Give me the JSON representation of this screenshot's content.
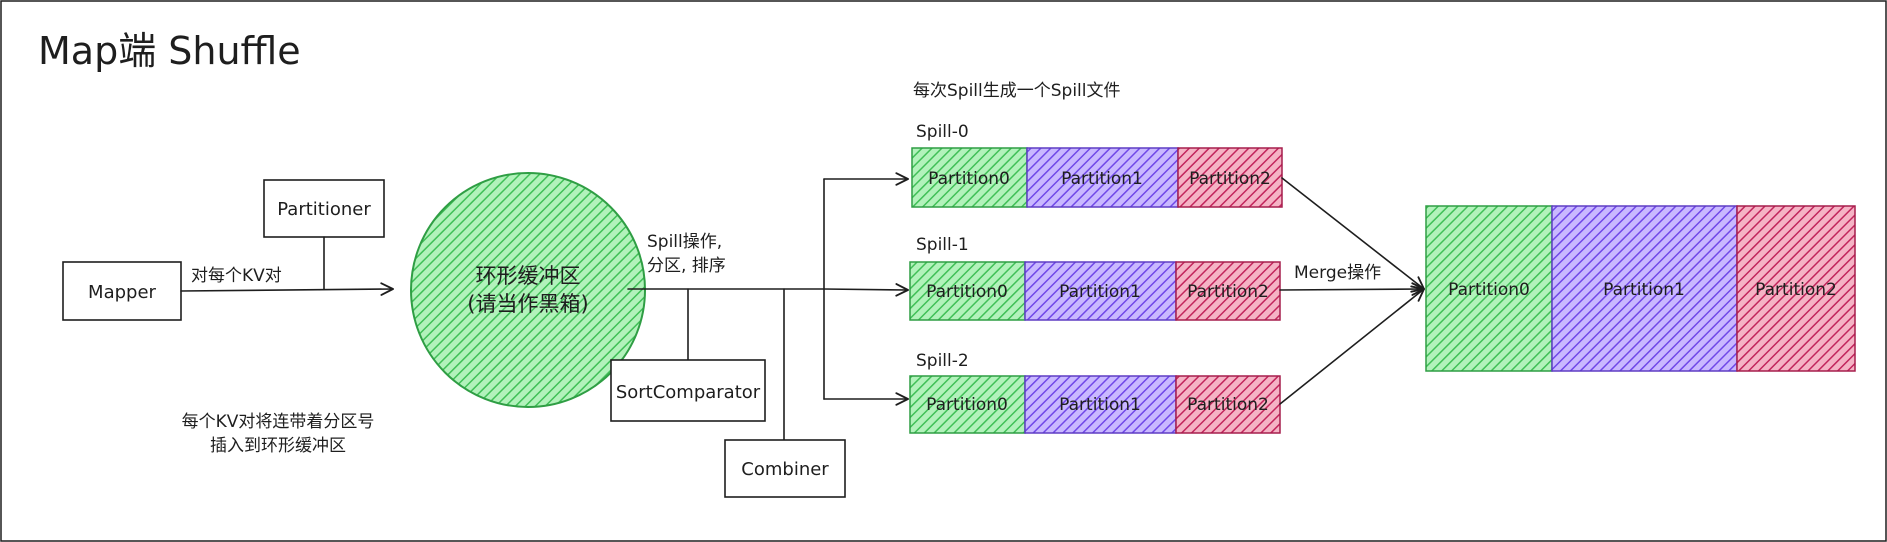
{
  "title": "Map端 Shuffle",
  "mapper_label": "Mapper",
  "partitioner_label": "Partitioner",
  "per_kv_label": "对每个KV对",
  "buffer_label_line1": "环形缓冲区",
  "buffer_label_line2": "(请当作黑箱)",
  "note_line1": "每个KV对将连带着分区号",
  "note_line2": "插入到环形缓冲区",
  "spill_op_line1": "Spill操作,",
  "spill_op_line2": "分区, 排序",
  "sort_comparator_label": "SortComparator",
  "combiner_label": "Combiner",
  "spill_note": "每次Spill生成一个Spill文件",
  "spills": [
    {
      "name": "Spill-0",
      "partitions": [
        "Partition0",
        "Partition1",
        "Partition2"
      ]
    },
    {
      "name": "Spill-1",
      "partitions": [
        "Partition0",
        "Partition1",
        "Partition2"
      ]
    },
    {
      "name": "Spill-2",
      "partitions": [
        "Partition0",
        "Partition1",
        "Partition2"
      ]
    }
  ],
  "merge_label": "Merge操作",
  "merged_partitions": [
    "Partition0",
    "Partition1",
    "Partition2"
  ],
  "colors": {
    "partition0": "#40c057",
    "partition1": "#7048e8",
    "partition2": "#c2255c",
    "buffer_fill": "#40c057",
    "buffer_stroke": "#2f9e44"
  }
}
